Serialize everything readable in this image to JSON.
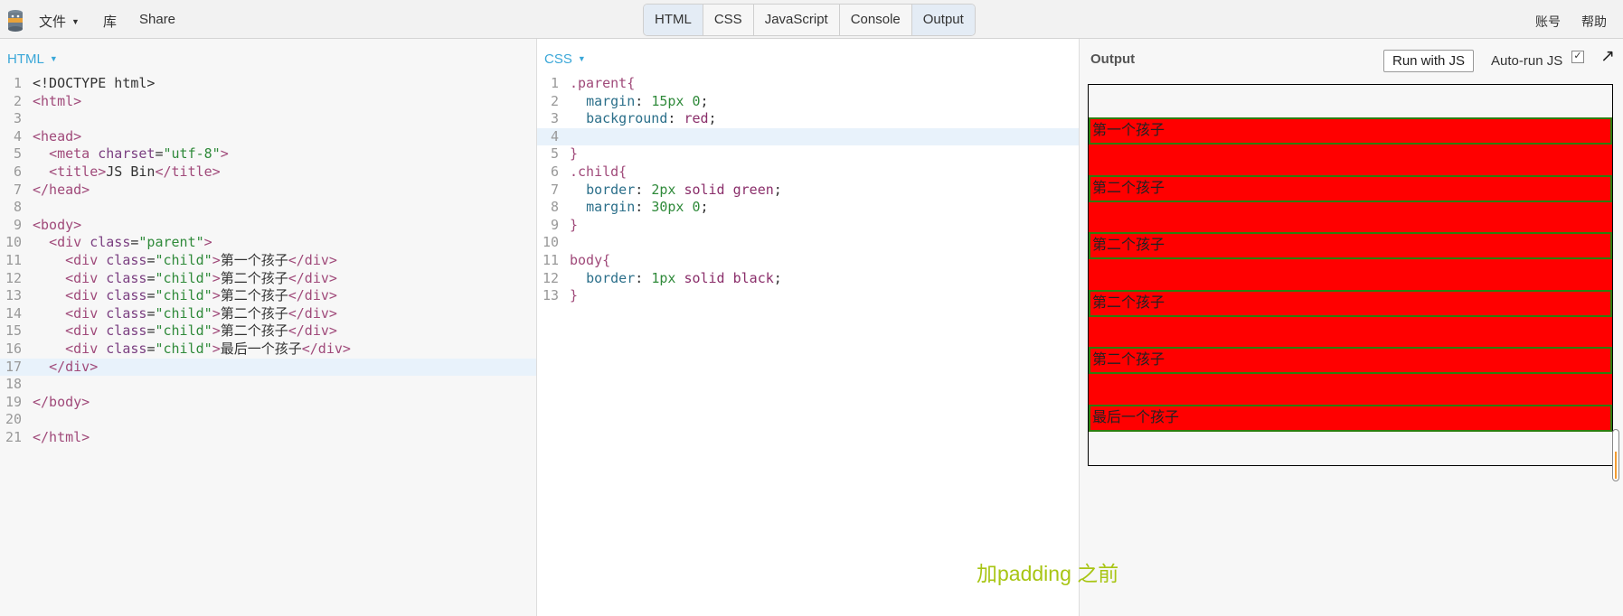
{
  "topbar": {
    "menu": [
      "文件",
      "库",
      "Share"
    ],
    "tabs": [
      "HTML",
      "CSS",
      "JavaScript",
      "Console",
      "Output"
    ],
    "right": [
      "账号",
      "帮助"
    ]
  },
  "html_panel": {
    "label": "HTML",
    "lines": [
      [
        [
          "p",
          "<!DOCTYPE html>"
        ]
      ],
      [
        [
          "t",
          "<html>"
        ]
      ],
      [],
      [
        [
          "t",
          "<head>"
        ]
      ],
      [
        [
          "p",
          "  "
        ],
        [
          "t",
          "<meta "
        ],
        [
          "a",
          "charset"
        ],
        [
          "p",
          "="
        ],
        [
          "s",
          "\"utf-8\""
        ],
        [
          "t",
          ">"
        ]
      ],
      [
        [
          "p",
          "  "
        ],
        [
          "t",
          "<title>"
        ],
        [
          "p",
          "JS Bin"
        ],
        [
          "t",
          "</title>"
        ]
      ],
      [
        [
          "t",
          "</head>"
        ]
      ],
      [],
      [
        [
          "t",
          "<body>"
        ]
      ],
      [
        [
          "p",
          "  "
        ],
        [
          "t",
          "<div "
        ],
        [
          "a",
          "class"
        ],
        [
          "p",
          "="
        ],
        [
          "s",
          "\"parent\""
        ],
        [
          "t",
          ">"
        ]
      ],
      [
        [
          "p",
          "    "
        ],
        [
          "t",
          "<div "
        ],
        [
          "a",
          "class"
        ],
        [
          "p",
          "="
        ],
        [
          "s",
          "\"child\""
        ],
        [
          "t",
          ">"
        ],
        [
          "p",
          "第一个孩子"
        ],
        [
          "t",
          "</div>"
        ]
      ],
      [
        [
          "p",
          "    "
        ],
        [
          "t",
          "<div "
        ],
        [
          "a",
          "class"
        ],
        [
          "p",
          "="
        ],
        [
          "s",
          "\"child\""
        ],
        [
          "t",
          ">"
        ],
        [
          "p",
          "第二个孩子"
        ],
        [
          "t",
          "</div>"
        ]
      ],
      [
        [
          "p",
          "    "
        ],
        [
          "t",
          "<div "
        ],
        [
          "a",
          "class"
        ],
        [
          "p",
          "="
        ],
        [
          "s",
          "\"child\""
        ],
        [
          "t",
          ">"
        ],
        [
          "p",
          "第二个孩子"
        ],
        [
          "t",
          "</div>"
        ]
      ],
      [
        [
          "p",
          "    "
        ],
        [
          "t",
          "<div "
        ],
        [
          "a",
          "class"
        ],
        [
          "p",
          "="
        ],
        [
          "s",
          "\"child\""
        ],
        [
          "t",
          ">"
        ],
        [
          "p",
          "第二个孩子"
        ],
        [
          "t",
          "</div>"
        ]
      ],
      [
        [
          "p",
          "    "
        ],
        [
          "t",
          "<div "
        ],
        [
          "a",
          "class"
        ],
        [
          "p",
          "="
        ],
        [
          "s",
          "\"child\""
        ],
        [
          "t",
          ">"
        ],
        [
          "p",
          "第二个孩子"
        ],
        [
          "t",
          "</div>"
        ]
      ],
      [
        [
          "p",
          "    "
        ],
        [
          "t",
          "<div "
        ],
        [
          "a",
          "class"
        ],
        [
          "p",
          "="
        ],
        [
          "s",
          "\"child\""
        ],
        [
          "t",
          ">"
        ],
        [
          "p",
          "最后一个孩子"
        ],
        [
          "t",
          "</div>"
        ]
      ],
      [
        [
          "p",
          "  "
        ],
        [
          "t",
          "</div>"
        ]
      ],
      [],
      [
        [
          "t",
          "</body>"
        ]
      ],
      [],
      [
        [
          "t",
          "</html>"
        ]
      ]
    ],
    "highlight_line": 17
  },
  "css_panel": {
    "label": "CSS",
    "lines": [
      [
        [
          "sel",
          ".parent{"
        ]
      ],
      [
        [
          "p",
          "  "
        ],
        [
          "prop",
          "margin"
        ],
        [
          "p",
          ": "
        ],
        [
          "num",
          "15px"
        ],
        [
          "p",
          " "
        ],
        [
          "num",
          "0"
        ],
        [
          "p",
          ";"
        ]
      ],
      [
        [
          "p",
          "  "
        ],
        [
          "prop",
          "background"
        ],
        [
          "p",
          ": "
        ],
        [
          "val",
          "red"
        ],
        [
          "p",
          ";"
        ]
      ],
      [],
      [
        [
          "sel",
          "}"
        ]
      ],
      [
        [
          "sel",
          ".child{"
        ]
      ],
      [
        [
          "p",
          "  "
        ],
        [
          "prop",
          "border"
        ],
        [
          "p",
          ": "
        ],
        [
          "num",
          "2px"
        ],
        [
          "p",
          " "
        ],
        [
          "val",
          "solid"
        ],
        [
          "p",
          " "
        ],
        [
          "val",
          "green"
        ],
        [
          "p",
          ";"
        ]
      ],
      [
        [
          "p",
          "  "
        ],
        [
          "prop",
          "margin"
        ],
        [
          "p",
          ": "
        ],
        [
          "num",
          "30px"
        ],
        [
          "p",
          " "
        ],
        [
          "num",
          "0"
        ],
        [
          "p",
          ";"
        ]
      ],
      [
        [
          "sel",
          "}"
        ]
      ],
      [],
      [
        [
          "sel",
          "body{"
        ]
      ],
      [
        [
          "p",
          "  "
        ],
        [
          "prop",
          "border"
        ],
        [
          "p",
          ": "
        ],
        [
          "num",
          "1px"
        ],
        [
          "p",
          " "
        ],
        [
          "val",
          "solid"
        ],
        [
          "p",
          " "
        ],
        [
          "val",
          "black"
        ],
        [
          "p",
          ";"
        ]
      ],
      [
        [
          "sel",
          "}"
        ]
      ]
    ],
    "highlight_line": 4
  },
  "output_panel": {
    "label": "Output",
    "run_label": "Run with JS",
    "autorun_label": "Auto-run JS",
    "autorun_checked": true,
    "children": [
      "第一个孩子",
      "第二个孩子",
      "第二个孩子",
      "第二个孩子",
      "第二个孩子",
      "最后一个孩子"
    ]
  },
  "caption": "加padding 之前"
}
